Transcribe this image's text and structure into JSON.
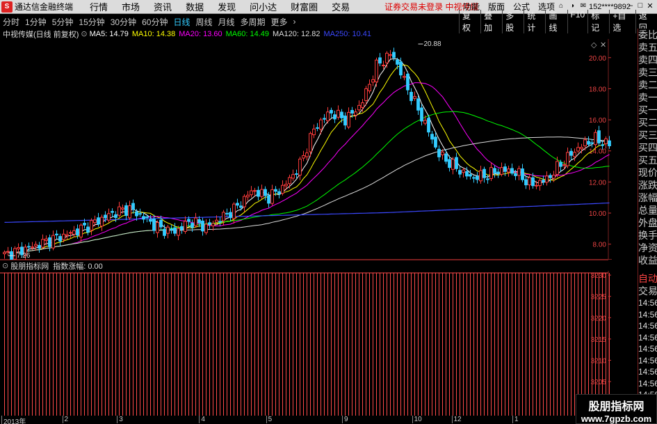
{
  "app": {
    "logo": "S",
    "title": "通达信金融终端",
    "menu": [
      "行情",
      "市场",
      "资讯",
      "数据",
      "发现",
      "问小达",
      "财富圈",
      "交易"
    ],
    "notice": "证券交易未登录  中视传媒",
    "right_menu": [
      "功能",
      "版面",
      "公式",
      "选项"
    ],
    "user": "152****9892"
  },
  "periods": [
    "分时",
    "1分钟",
    "5分钟",
    "15分钟",
    "30分钟",
    "60分钟",
    "日线",
    "周线",
    "月线",
    "多周期",
    "更多"
  ],
  "active_period": "日线",
  "tools": [
    "复权",
    "叠加",
    "多股",
    "统计",
    "画线",
    "F10",
    "标记",
    "+自选",
    "返回"
  ],
  "stock_title": "中视传媒(日线 前复权)",
  "ma_values": [
    {
      "label": "MA5: 14.79",
      "color": "#ffffff"
    },
    {
      "label": "MA10: 14.38",
      "color": "#ffff00"
    },
    {
      "label": "MA20: 13.60",
      "color": "#ff00ff"
    },
    {
      "label": "MA60: 14.49",
      "color": "#00ff00"
    },
    {
      "label": "MA120: 12.82",
      "color": "#dddddd"
    },
    {
      "label": "MA250: 10.41",
      "color": "#3b48ff"
    }
  ],
  "sub_indicator": {
    "name": "股朋指标网",
    "label": "指数涨幅: 0.00"
  },
  "right_panel": [
    "委比",
    "卖五",
    "卖四",
    "卖三",
    "卖二",
    "卖一",
    "买一",
    "买二",
    "买三",
    "买四",
    "买五",
    "现价",
    "涨跌",
    "涨幅",
    "总量",
    "外盘",
    "换手",
    "净资",
    "收益"
  ],
  "right_panel_lower": [
    "自动",
    "交易",
    "14:56",
    "14:56",
    "14:56",
    "14:56",
    "14:56",
    "14:56",
    "14:56",
    "14:56",
    "14:56",
    "14:56"
  ],
  "watermark": {
    "line1": "股朋指标网",
    "line2": "www.7gpzb.com"
  },
  "chart_data": [
    {
      "type": "candlestick",
      "title": "中视传媒(日线 前复权)",
      "y_ticks": [
        8.0,
        10.0,
        12.0,
        14.0,
        16.0,
        18.0,
        20.0
      ],
      "ylim": [
        7.0,
        21.2
      ],
      "annotations": [
        {
          "label": "20.88",
          "value": 20.88
        },
        {
          "label": "7.26",
          "value": 7.26
        }
      ],
      "x_ticks": [
        {
          "label": "2013年",
          "pos": 0.0
        },
        {
          "label": "2",
          "pos": 0.1
        },
        {
          "label": "3",
          "pos": 0.19
        },
        {
          "label": "4",
          "pos": 0.325
        },
        {
          "label": "5",
          "pos": 0.435
        },
        {
          "label": "9",
          "pos": 0.56
        },
        {
          "label": "10",
          "pos": 0.675
        },
        {
          "label": "12",
          "pos": 0.74
        },
        {
          "label": "1",
          "pos": 0.84
        }
      ],
      "series": [
        {
          "name": "MA5",
          "color": "#ffffff"
        },
        {
          "name": "MA10",
          "color": "#ffff00"
        },
        {
          "name": "MA20",
          "color": "#ff00ff"
        },
        {
          "name": "MA60",
          "color": "#00ff00"
        },
        {
          "name": "MA120",
          "color": "#dddddd"
        },
        {
          "name": "MA250",
          "color": "#3b48ff"
        }
      ],
      "close_path": [
        7.3,
        7.6,
        7.9,
        8.3,
        8.6,
        9.0,
        9.5,
        10.0,
        10.3,
        9.7,
        9.0,
        8.8,
        9.5,
        9.1,
        9.7,
        10.4,
        11.5,
        11.0,
        11.7,
        13.0,
        15.5,
        16.5,
        16.0,
        17.0,
        19.5,
        20.3,
        18.0,
        16.0,
        13.8,
        13.0,
        12.3,
        12.4,
        12.8,
        12.6,
        11.8,
        12.2,
        13.3,
        14.2,
        14.8,
        14.4
      ]
    },
    {
      "type": "bar",
      "title": "指数涨幅",
      "y_ticks": [
        3200,
        3205,
        3210,
        3215,
        3220,
        3225,
        3230
      ],
      "ylim": [
        3197,
        3231
      ]
    }
  ]
}
